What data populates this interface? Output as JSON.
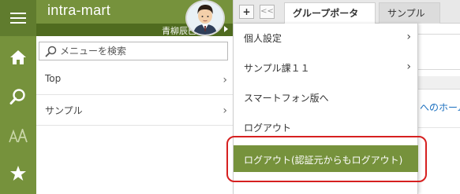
{
  "brand": {
    "name": "intra-mart"
  },
  "user": {
    "name": "青柳辰巳"
  },
  "rail": {
    "items": [
      {
        "icon": "hamburger-icon"
      },
      {
        "icon": "home-icon"
      },
      {
        "icon": "search-icon"
      },
      {
        "icon": "font-size-icon"
      },
      {
        "icon": "star-icon"
      }
    ]
  },
  "search": {
    "placeholder": "メニューを検索",
    "value": ""
  },
  "menu": {
    "items": [
      {
        "label": "Top",
        "chevron": "›"
      },
      {
        "label": "サンプル",
        "chevron": "›"
      }
    ]
  },
  "tabs": {
    "plus": "+",
    "prev": "<<",
    "items": [
      {
        "label": "グループポータル"
      },
      {
        "label": "サンプル"
      }
    ]
  },
  "background": {
    "link_text": "へのホーム"
  },
  "dropdown": {
    "items": [
      {
        "label": "個人設定",
        "chevron": "›"
      },
      {
        "label": "サンプル課１１",
        "chevron": "›"
      },
      {
        "label": "スマートフォン版へ"
      },
      {
        "label": "ログアウト"
      },
      {
        "label": "ログアウト(認証元からもログアウト)"
      }
    ]
  },
  "colors": {
    "accent": "#76923c",
    "accent_dark": "#4f6b1f",
    "highlight": "#d62020",
    "link": "#1a6fbf"
  }
}
